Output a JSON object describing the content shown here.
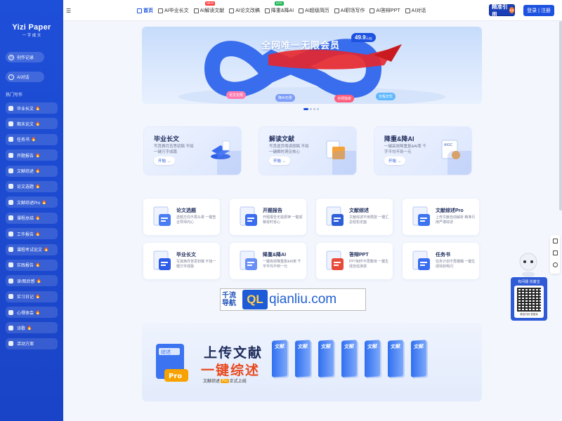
{
  "brand": {
    "name": "Yizi Paper",
    "subtitle": "一 字 成 文"
  },
  "sidebar": {
    "history_label": "创作记录",
    "ai_chat_label": "AI对话",
    "section_title": "热门写作",
    "items": [
      {
        "label": "毕业长文",
        "hot": true
      },
      {
        "label": "期末论文",
        "hot": true
      },
      {
        "label": "任务书",
        "hot": true
      },
      {
        "label": "开题报告",
        "hot": true
      },
      {
        "label": "文献综述",
        "hot": true
      },
      {
        "label": "论文选题",
        "hot": true
      },
      {
        "label": "文献综述Pro",
        "hot": true
      },
      {
        "label": "课程总结",
        "hot": true
      },
      {
        "label": "工作报告",
        "hot": true
      },
      {
        "label": "课程考试论文",
        "hot": true
      },
      {
        "label": "实践报告",
        "hot": true
      },
      {
        "label": "读/观后感",
        "hot": true
      },
      {
        "label": "实习日记",
        "hot": true
      },
      {
        "label": "心得体会",
        "hot": true
      },
      {
        "label": "诗歌",
        "hot": true
      },
      {
        "label": "活动方案",
        "hot": false
      }
    ],
    "fire_glyph": "🔥"
  },
  "topnav": {
    "items": [
      {
        "label": "首页",
        "active": true
      },
      {
        "label": "AI毕业长文"
      },
      {
        "label": "AI解读文献",
        "tag": "NEW"
      },
      {
        "label": "AI论文改稿"
      },
      {
        "label": "降重&降AI",
        "tag": "≤5%"
      },
      {
        "label": "AI超级简历"
      },
      {
        "label": "AI职场写作"
      },
      {
        "label": "AI答辩PPT"
      },
      {
        "label": "AI对话"
      }
    ],
    "cite_label": "精准引用",
    "cite_version": "4.0",
    "login_label": "登录",
    "register_label": "注册",
    "login_sep": "|"
  },
  "banner": {
    "title": "全网唯一无限会员",
    "price": "49.9",
    "price_unit": "元/起",
    "bubbles": [
      "论文无限",
      "降AI无限",
      "全网独家",
      "全程无忧"
    ]
  },
  "big_cards": [
    {
      "title": "毕业长文",
      "desc": "写其俩月苦思初稿 不如一键万字成篇",
      "go": "开始"
    },
    {
      "title": "解读文献",
      "desc": "写其逐页啃读原稿 不如一键瞬时洞见核心",
      "go": "开始"
    },
    {
      "title": "降重&降AI",
      "desc": "一键高效降重复&AI率 千字平均不到一元",
      "go": "开始"
    }
  ],
  "small_cards": [
    {
      "title": "论文选题",
      "desc": "选题方向不再头晕 一键查合导师内心"
    },
    {
      "title": "开题报告",
      "desc": "开题报告无需费神 一键成稿省时省心"
    },
    {
      "title": "文献综述",
      "desc": "文献综述不用再愁 一键汇总轻松定面"
    },
    {
      "title": "文献综述Pro",
      "desc": "上传文献自动解析 精准引用严谨综述"
    },
    {
      "title": "毕业长文",
      "desc": "写其俩月苦思初稿 不如一键万字成篇"
    },
    {
      "title": "降重&降AI",
      "desc": "一键高效降重复&AI率 千字平均不到一元"
    },
    {
      "title": "答辩PPT",
      "desc": "PPT制作不再繁琐 一键生成自信演讲"
    },
    {
      "title": "任务书",
      "desc": "任务计划不再模糊 一键生成快如电闪"
    }
  ],
  "watermark": {
    "cn1": "千流",
    "cn2": "导航",
    "badge": "QL",
    "url": "qianliu.com"
  },
  "promo": {
    "line1": "上传文献",
    "line2": "一键综述",
    "sub_prefix": "文献综述",
    "pro": "Pro",
    "sub_suffix": "正式上线",
    "box_label": "综述",
    "book_label": "文献"
  },
  "helper": {
    "title": "有问题 找童宝",
    "caption": "微信扫码 童童我"
  }
}
